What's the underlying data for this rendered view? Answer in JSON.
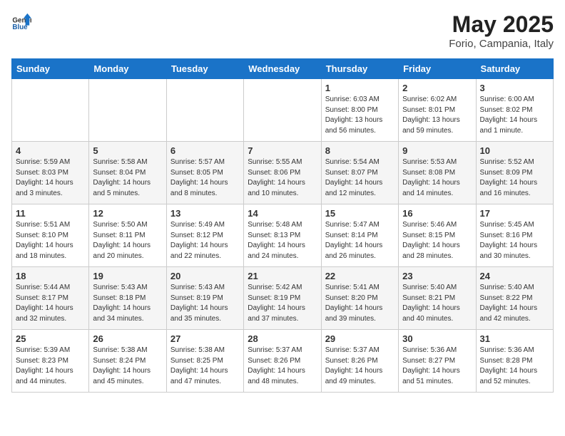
{
  "header": {
    "logo_general": "General",
    "logo_blue": "Blue",
    "month_year": "May 2025",
    "location": "Forio, Campania, Italy"
  },
  "weekdays": [
    "Sunday",
    "Monday",
    "Tuesday",
    "Wednesday",
    "Thursday",
    "Friday",
    "Saturday"
  ],
  "weeks": [
    [
      {
        "day": "",
        "info": ""
      },
      {
        "day": "",
        "info": ""
      },
      {
        "day": "",
        "info": ""
      },
      {
        "day": "",
        "info": ""
      },
      {
        "day": "1",
        "info": "Sunrise: 6:03 AM\nSunset: 8:00 PM\nDaylight: 13 hours and 56 minutes."
      },
      {
        "day": "2",
        "info": "Sunrise: 6:02 AM\nSunset: 8:01 PM\nDaylight: 13 hours and 59 minutes."
      },
      {
        "day": "3",
        "info": "Sunrise: 6:00 AM\nSunset: 8:02 PM\nDaylight: 14 hours and 1 minute."
      }
    ],
    [
      {
        "day": "4",
        "info": "Sunrise: 5:59 AM\nSunset: 8:03 PM\nDaylight: 14 hours and 3 minutes."
      },
      {
        "day": "5",
        "info": "Sunrise: 5:58 AM\nSunset: 8:04 PM\nDaylight: 14 hours and 5 minutes."
      },
      {
        "day": "6",
        "info": "Sunrise: 5:57 AM\nSunset: 8:05 PM\nDaylight: 14 hours and 8 minutes."
      },
      {
        "day": "7",
        "info": "Sunrise: 5:55 AM\nSunset: 8:06 PM\nDaylight: 14 hours and 10 minutes."
      },
      {
        "day": "8",
        "info": "Sunrise: 5:54 AM\nSunset: 8:07 PM\nDaylight: 14 hours and 12 minutes."
      },
      {
        "day": "9",
        "info": "Sunrise: 5:53 AM\nSunset: 8:08 PM\nDaylight: 14 hours and 14 minutes."
      },
      {
        "day": "10",
        "info": "Sunrise: 5:52 AM\nSunset: 8:09 PM\nDaylight: 14 hours and 16 minutes."
      }
    ],
    [
      {
        "day": "11",
        "info": "Sunrise: 5:51 AM\nSunset: 8:10 PM\nDaylight: 14 hours and 18 minutes."
      },
      {
        "day": "12",
        "info": "Sunrise: 5:50 AM\nSunset: 8:11 PM\nDaylight: 14 hours and 20 minutes."
      },
      {
        "day": "13",
        "info": "Sunrise: 5:49 AM\nSunset: 8:12 PM\nDaylight: 14 hours and 22 minutes."
      },
      {
        "day": "14",
        "info": "Sunrise: 5:48 AM\nSunset: 8:13 PM\nDaylight: 14 hours and 24 minutes."
      },
      {
        "day": "15",
        "info": "Sunrise: 5:47 AM\nSunset: 8:14 PM\nDaylight: 14 hours and 26 minutes."
      },
      {
        "day": "16",
        "info": "Sunrise: 5:46 AM\nSunset: 8:15 PM\nDaylight: 14 hours and 28 minutes."
      },
      {
        "day": "17",
        "info": "Sunrise: 5:45 AM\nSunset: 8:16 PM\nDaylight: 14 hours and 30 minutes."
      }
    ],
    [
      {
        "day": "18",
        "info": "Sunrise: 5:44 AM\nSunset: 8:17 PM\nDaylight: 14 hours and 32 minutes."
      },
      {
        "day": "19",
        "info": "Sunrise: 5:43 AM\nSunset: 8:18 PM\nDaylight: 14 hours and 34 minutes."
      },
      {
        "day": "20",
        "info": "Sunrise: 5:43 AM\nSunset: 8:19 PM\nDaylight: 14 hours and 35 minutes."
      },
      {
        "day": "21",
        "info": "Sunrise: 5:42 AM\nSunset: 8:19 PM\nDaylight: 14 hours and 37 minutes."
      },
      {
        "day": "22",
        "info": "Sunrise: 5:41 AM\nSunset: 8:20 PM\nDaylight: 14 hours and 39 minutes."
      },
      {
        "day": "23",
        "info": "Sunrise: 5:40 AM\nSunset: 8:21 PM\nDaylight: 14 hours and 40 minutes."
      },
      {
        "day": "24",
        "info": "Sunrise: 5:40 AM\nSunset: 8:22 PM\nDaylight: 14 hours and 42 minutes."
      }
    ],
    [
      {
        "day": "25",
        "info": "Sunrise: 5:39 AM\nSunset: 8:23 PM\nDaylight: 14 hours and 44 minutes."
      },
      {
        "day": "26",
        "info": "Sunrise: 5:38 AM\nSunset: 8:24 PM\nDaylight: 14 hours and 45 minutes."
      },
      {
        "day": "27",
        "info": "Sunrise: 5:38 AM\nSunset: 8:25 PM\nDaylight: 14 hours and 47 minutes."
      },
      {
        "day": "28",
        "info": "Sunrise: 5:37 AM\nSunset: 8:26 PM\nDaylight: 14 hours and 48 minutes."
      },
      {
        "day": "29",
        "info": "Sunrise: 5:37 AM\nSunset: 8:26 PM\nDaylight: 14 hours and 49 minutes."
      },
      {
        "day": "30",
        "info": "Sunrise: 5:36 AM\nSunset: 8:27 PM\nDaylight: 14 hours and 51 minutes."
      },
      {
        "day": "31",
        "info": "Sunrise: 5:36 AM\nSunset: 8:28 PM\nDaylight: 14 hours and 52 minutes."
      }
    ]
  ]
}
